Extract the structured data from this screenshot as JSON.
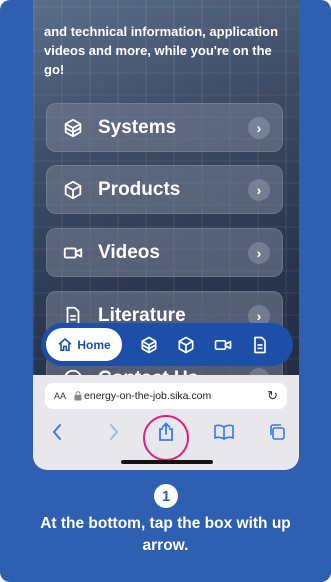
{
  "intro_text": "and technical information, application videos and more, while you're on the go!",
  "menu": [
    {
      "label": "Systems",
      "icon": "systems-icon"
    },
    {
      "label": "Products",
      "icon": "products-icon"
    },
    {
      "label": "Videos",
      "icon": "videos-icon"
    },
    {
      "label": "Literature",
      "icon": "literature-icon"
    },
    {
      "label": "Contact Us",
      "icon": "contact-icon"
    }
  ],
  "chevron": "›",
  "bottom_nav": {
    "home_label": "Home"
  },
  "safari": {
    "aa_label": "AA",
    "url": "energy-on-the-job.sika.com",
    "reload_glyph": "↻"
  },
  "step": {
    "number": "1",
    "instruction": "At the bottom, tap the box with up arrow."
  },
  "colors": {
    "card_bg": "#2e5fb0",
    "nav_blue": "#1e4fa8",
    "highlight": "#e0237a",
    "safari_blue": "#3478f6"
  }
}
